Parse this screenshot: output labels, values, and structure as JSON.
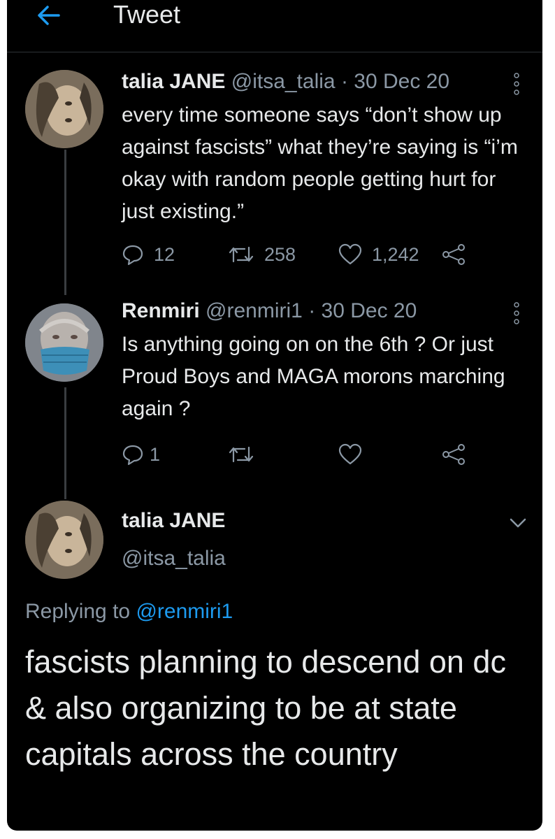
{
  "header": {
    "title": "Tweet"
  },
  "tweets": [
    {
      "name": "talia JANE",
      "handle": "@itsa_talia",
      "sep": "·",
      "date": "30 Dec 20",
      "text": "every time someone says “don’t show up against fascists” what they’re saying is “i’m okay with random people getting hurt for just existing.”",
      "replies": "12",
      "retweets": "258",
      "likes": "1,242"
    },
    {
      "name": "Renmiri",
      "handle": "@renmiri1",
      "sep": "·",
      "date": "30 Dec 20",
      "text": "Is anything going on on the 6th ? Or just Proud Boys and MAGA morons marching again ?",
      "replies": "1",
      "retweets": "",
      "likes": ""
    }
  ],
  "main": {
    "name": "talia JANE",
    "handle": "@itsa_talia",
    "replying_prefix": "Replying to",
    "replying_to": "@renmiri1",
    "text": "fascists planning to descend on dc & also organizing to be at state capitals across the country"
  },
  "icons": {
    "back": "arrow-left-icon",
    "more": "more-vertical-icon",
    "reply": "reply-icon",
    "retweet": "retweet-icon",
    "like": "heart-icon",
    "share": "share-icon",
    "caret": "chevron-down-icon"
  },
  "colors": {
    "background": "#000000",
    "text": "#e7e9ea",
    "muted": "#8b98a5",
    "accent": "#1d9bf0"
  }
}
